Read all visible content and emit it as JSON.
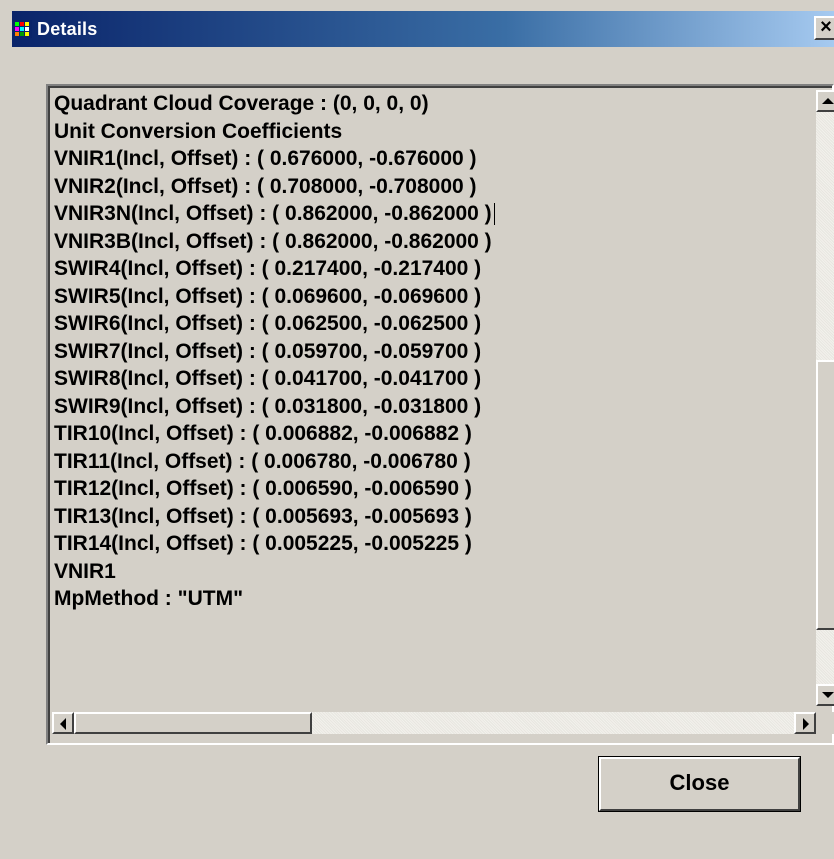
{
  "window": {
    "title": "Details",
    "close_glyph": "×",
    "icon": "app-icon"
  },
  "content": {
    "lines": [
      "Quadrant Cloud Coverage : (0, 0, 0, 0)",
      "Unit Conversion Coefficients",
      "VNIR1(Incl, Offset) : ( 0.676000, -0.676000 )",
      "VNIR2(Incl, Offset) : ( 0.708000, -0.708000 )",
      "VNIR3N(Incl, Offset) : ( 0.862000, -0.862000 )",
      "VNIR3B(Incl, Offset) : ( 0.862000, -0.862000 )",
      "SWIR4(Incl, Offset) : ( 0.217400, -0.217400 )",
      "SWIR5(Incl, Offset) : ( 0.069600, -0.069600 )",
      "SWIR6(Incl, Offset) : ( 0.062500, -0.062500 )",
      "SWIR7(Incl, Offset) : ( 0.059700, -0.059700 )",
      "SWIR8(Incl, Offset) : ( 0.041700, -0.041700 )",
      "SWIR9(Incl, Offset) : ( 0.031800, -0.031800 )",
      "TIR10(Incl, Offset) : ( 0.006882, -0.006882 )",
      "TIR11(Incl, Offset) : ( 0.006780, -0.006780 )",
      "TIR12(Incl, Offset) : ( 0.006590, -0.006590 )",
      "TIR13(Incl, Offset) : ( 0.005693, -0.005693 )",
      "TIR14(Incl, Offset) : ( 0.005225, -0.005225 )",
      "VNIR1",
      "MpMethod : \"UTM\""
    ]
  },
  "buttons": {
    "close_label": "Close"
  },
  "colors": {
    "titlebar_start": "#0a246a",
    "titlebar_end": "#a6caf0",
    "dialog_bg": "#d4d0c8"
  }
}
